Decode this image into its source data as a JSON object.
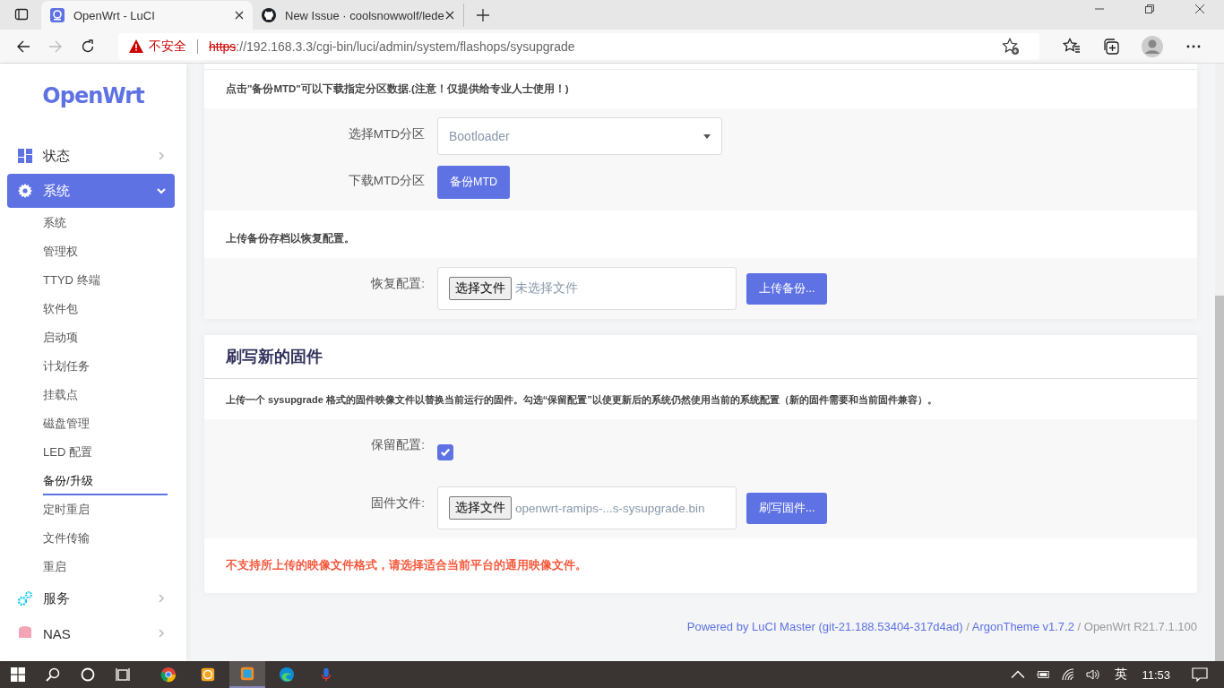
{
  "browser": {
    "tabs": [
      {
        "title": "OpenWrt - LuCI",
        "selected": true,
        "kind": "openwrt"
      },
      {
        "title": "New Issue · coolsnowwolf/lede",
        "selected": false,
        "kind": "github"
      }
    ],
    "security": "不安全",
    "scheme": "https",
    "url": "://192.168.3.3/cgi-bin/luci/admin/system/flashops/sysupgrade"
  },
  "sidebar": {
    "logo": "OpenWrt",
    "menu": [
      {
        "label": "状态",
        "expanded": false,
        "selected": false
      },
      {
        "label": "系统",
        "expanded": true,
        "selected": true,
        "children": [
          {
            "label": "系统",
            "selected": false
          },
          {
            "label": "管理权",
            "selected": false
          },
          {
            "label": "TTYD 终端",
            "selected": false
          },
          {
            "label": "软件包",
            "selected": false
          },
          {
            "label": "启动项",
            "selected": false
          },
          {
            "label": "计划任务",
            "selected": false
          },
          {
            "label": "挂载点",
            "selected": false
          },
          {
            "label": "磁盘管理",
            "selected": false
          },
          {
            "label": "LED 配置",
            "selected": false
          },
          {
            "label": "备份/升级",
            "selected": true
          },
          {
            "label": "定时重启",
            "selected": false
          },
          {
            "label": "文件传输",
            "selected": false
          },
          {
            "label": "重启",
            "selected": false
          }
        ]
      },
      {
        "label": "服务",
        "expanded": false,
        "selected": false
      },
      {
        "label": "NAS",
        "expanded": false,
        "selected": false
      }
    ]
  },
  "mtd": {
    "description": "点击\"备份MTD\"可以下载指定分区数据.(注意！仅提供给专业人士使用！)",
    "select_label": "选择MTD分区",
    "select_value": "Bootloader",
    "download_label": "下载MTD分区",
    "download_button": "备份MTD"
  },
  "restore": {
    "description": "上传备份存档以恢复配置。",
    "label": "恢复配置:",
    "choose_button": "选择文件",
    "file_name": "未选择文件",
    "upload_button": "上传备份..."
  },
  "flash": {
    "title": "刷写新的固件",
    "description": "上传一个 sysupgrade 格式的固件映像文件以替换当前运行的固件。勾选“保留配置”以使更新后的系统仍然使用当前的系统配置（新的固件需要和当前固件兼容）。",
    "keep_label": "保留配置:",
    "keep_checked": true,
    "file_label": "固件文件:",
    "choose_button": "选择文件",
    "file_name": "openwrt-ramips-...s-sysupgrade.bin",
    "flash_button": "刷写固件...",
    "error": "不支持所上传的映像文件格式，请选择适合当前平台的通用映像文件。"
  },
  "footer": [
    {
      "text": "Powered by LuCI Master (git-21.188.53404-317d4ad)",
      "kind": "link"
    },
    {
      "text": " / ",
      "kind": "plain"
    },
    {
      "text": "ArgonTheme v1.7.2",
      "kind": "link"
    },
    {
      "text": " / OpenWrt R21.7.1.100",
      "kind": "plain"
    }
  ],
  "taskbar": {
    "apps": [
      {
        "selected": false
      },
      {
        "selected": false
      },
      {
        "selected": true
      },
      {
        "selected": false
      },
      {
        "selected": false
      }
    ],
    "ime": "英",
    "time": "11:53"
  }
}
